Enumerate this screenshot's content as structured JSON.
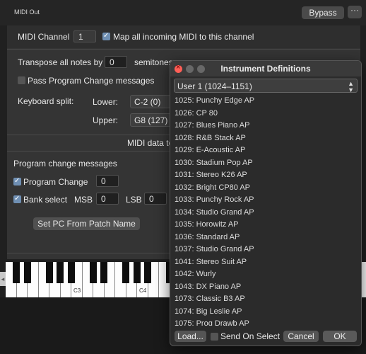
{
  "header": {
    "title": "MIDI Out",
    "bypass_label": "Bypass",
    "more_label": "···"
  },
  "main": {
    "midi_channel_label": "MIDI Channel",
    "midi_channel_value": "1",
    "map_midi_label": "Map all incoming MIDI to this channel",
    "transpose_label": "Transpose all notes by",
    "transpose_value": "0",
    "semitones_label": "semitones",
    "pass_program_change_label": "Pass Program Change messages",
    "keyboard_split_label": "Keyboard split:",
    "lower_label": "Lower:",
    "lower_value": "C-2 (0)",
    "upper_label": "Upper:",
    "upper_value": "G8 (127)",
    "midi_data_header": "MIDI data to send whe",
    "program_change_messages_label": "Program change messages",
    "program_change_label": "Program Change",
    "program_change_value": "0",
    "bank_select_label": "Bank select",
    "msb_label": "MSB",
    "msb_value": "0",
    "lsb_label": "LSB",
    "lsb_value": "0",
    "set_pc_button": "Set PC From Patch Name"
  },
  "keyboard": {
    "octave_labels": [
      "C3",
      "C4"
    ]
  },
  "dialog": {
    "title": "Instrument Definitions",
    "selected_bank": "User 1 (1024–1151)",
    "items": [
      "1025: Punchy Edge AP",
      "1026: CP 80",
      "1027: Blues Piano AP",
      "1028: R&B Stack AP",
      "1029: E-Acoustic AP",
      "1030: Stadium Pop AP",
      "1031: Stereo K26 AP",
      "1032: Bright CP80 AP",
      "1033: Punchy Rock AP",
      "1034: Studio Grand AP",
      "1035: Horowitz AP",
      "1036: Standard AP",
      "1037: Studio Grand AP",
      "1041: Stereo Suit AP",
      "1042: Wurly",
      "1043: DX Piano AP",
      "1073: Classic B3 AP",
      "1074: Big Leslie AP",
      "1075: Prog Drawb AP"
    ],
    "load_button": "Load...",
    "send_on_select_label": "Send On Select",
    "cancel_button": "Cancel",
    "ok_button": "OK"
  }
}
